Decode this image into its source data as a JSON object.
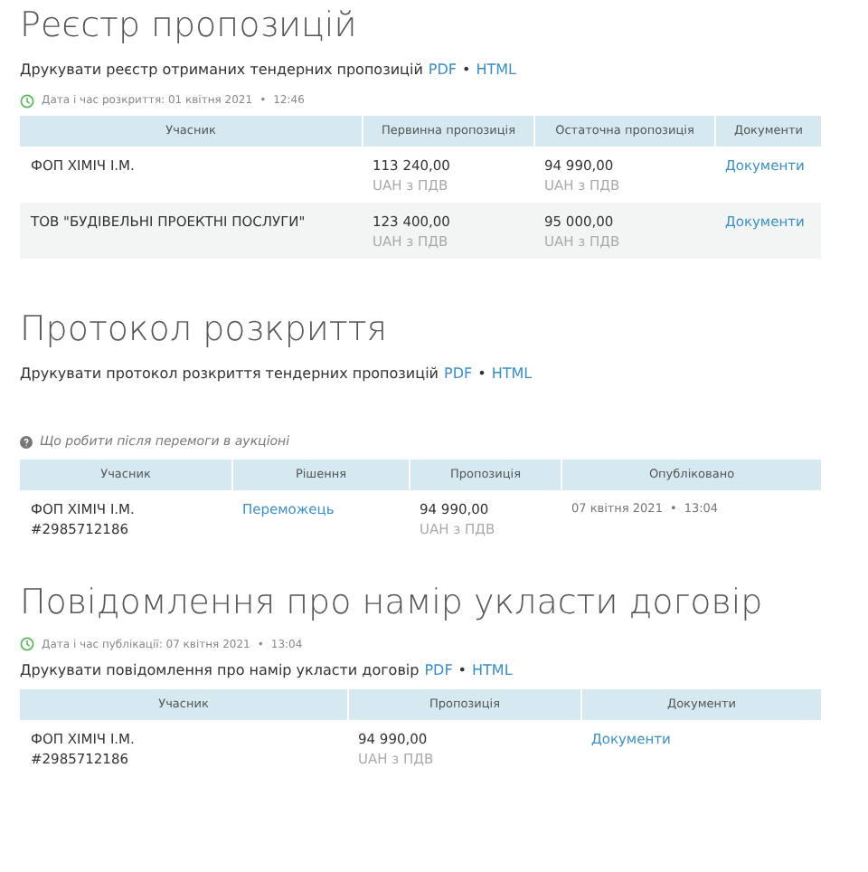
{
  "sections": [
    {
      "title": "Реєстр пропозицій",
      "blocks": [
        {
          "kind": "print",
          "text": "Друкувати реєстр отриманих тендерних пропозицій",
          "links": [
            "PDF",
            "HTML"
          ],
          "separator": "•"
        },
        {
          "kind": "date",
          "label": "Дата і час розкриття: 01 квітня 2021",
          "separator": "•",
          "time": "12:46"
        },
        {
          "kind": "table",
          "columns": [
            "Учасник",
            "Первинна пропозиція",
            "Остаточна пропозиція",
            "Документи"
          ],
          "rows": [
            [
              {
                "kind": "text",
                "text": "ФОП ХІМІЧ І.М."
              },
              {
                "kind": "text",
                "text": "113 240,00",
                "sub": "UAH з ПДВ"
              },
              {
                "kind": "text",
                "text": "94 990,00",
                "sub": "UAH з ПДВ"
              },
              {
                "kind": "link",
                "text": "Документи"
              }
            ],
            [
              {
                "kind": "text",
                "text": "ТОВ \"БУДІВЕЛЬНІ ПРОЕКТНІ ПОСЛУГИ\""
              },
              {
                "kind": "text",
                "text": "123 400,00",
                "sub": "UAH з ПДВ"
              },
              {
                "kind": "text",
                "text": "95 000,00",
                "sub": "UAH з ПДВ"
              },
              {
                "kind": "link",
                "text": "Документи"
              }
            ]
          ]
        }
      ]
    },
    {
      "title": "Протокол розкриття",
      "blocks": [
        {
          "kind": "print",
          "text": "Друкувати протокол розкриття тендерних пропозицій",
          "links": [
            "PDF",
            "HTML"
          ],
          "separator": "•"
        },
        {
          "kind": "help",
          "text": "Що робити після перемоги в аукціоні"
        },
        {
          "kind": "table",
          "columns": [
            "Учасник",
            "Рішення",
            "Пропозиція",
            "Опубліковано"
          ],
          "rows": [
            [
              {
                "kind": "text",
                "text": "ФОП ХІМІЧ І.М.",
                "sub2": "#2985712186"
              },
              {
                "kind": "link",
                "text": "Переможець"
              },
              {
                "kind": "text",
                "text": "94 990,00",
                "sub": "UAH з ПДВ"
              },
              {
                "kind": "datetime",
                "text": "07 квітня 2021",
                "separator": "•",
                "time": "13:04"
              }
            ]
          ]
        }
      ]
    },
    {
      "title": "Повідомлення про намір укласти договір",
      "blocks": [
        {
          "kind": "date",
          "label": "Дата і час публікації: 07 квітня 2021",
          "separator": "•",
          "time": "13:04"
        },
        {
          "kind": "print",
          "text": "Друкувати повідомлення про намір укласти договір",
          "links": [
            "PDF",
            "HTML"
          ],
          "separator": "•"
        },
        {
          "kind": "table",
          "columns": [
            "Учасник",
            "Пропозиція",
            "Документи"
          ],
          "rows": [
            [
              {
                "kind": "text",
                "text": "ФОП ХІМІЧ І.М.",
                "sub2": "#2985712186"
              },
              {
                "kind": "text",
                "text": "94 990,00",
                "sub": "UAH з ПДВ"
              },
              {
                "kind": "link",
                "text": "Документи"
              }
            ]
          ]
        }
      ]
    }
  ]
}
